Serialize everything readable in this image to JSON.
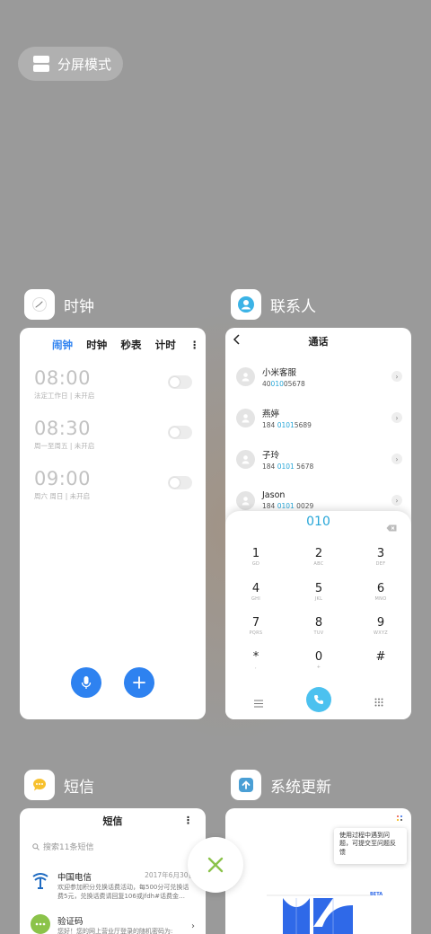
{
  "split_screen": {
    "label": "分屏模式"
  },
  "apps": {
    "clock": {
      "name": "时钟",
      "tabs": [
        "闹钟",
        "时钟",
        "秒表",
        "计时"
      ],
      "alarms": [
        {
          "time": "08:00",
          "sub": "法定工作日 | 未开启"
        },
        {
          "time": "08:30",
          "sub": "周一至周五 | 未开启"
        },
        {
          "time": "09:00",
          "sub": "周六 周日 | 未开启"
        }
      ]
    },
    "contacts": {
      "name": "联系人",
      "title": "通话",
      "items": [
        {
          "name": "小米客服",
          "num_pre": "40",
          "num_hl": "010",
          "num_post": "05678"
        },
        {
          "name": "燕婷",
          "num_pre": "184 ",
          "num_hl": "0101",
          "num_post": "5689"
        },
        {
          "name": "子玲",
          "num_pre": "184 ",
          "num_hl": "0101",
          "num_post": " 5678"
        },
        {
          "name": "Jason",
          "num_pre": "184 ",
          "num_hl": "0101",
          "num_post": " 0029"
        }
      ],
      "dialed": "010",
      "keys": [
        {
          "d": "1",
          "l": "GD"
        },
        {
          "d": "2",
          "l": "ABC"
        },
        {
          "d": "3",
          "l": "DEF"
        },
        {
          "d": "4",
          "l": "GHI"
        },
        {
          "d": "5",
          "l": "JKL"
        },
        {
          "d": "6",
          "l": "MNO"
        },
        {
          "d": "7",
          "l": "PQRS"
        },
        {
          "d": "8",
          "l": "TUV"
        },
        {
          "d": "9",
          "l": "WXYZ"
        },
        {
          "d": "*",
          "l": ","
        },
        {
          "d": "0",
          "l": "+"
        },
        {
          "d": "#",
          "l": ""
        }
      ]
    },
    "sms": {
      "name": "短信",
      "title": "短信",
      "search_placeholder": "搜索11条短信",
      "items": [
        {
          "sender": "中国电信",
          "date": "2017年6月30日",
          "preview": "欢迎参加积分兑换话费活动，每500分可兑换话费5元，兑换话费请回复106或jfdh#话费金…"
        },
        {
          "sender": "验证码",
          "date": "",
          "preview": "您好！您的网上营业厅登录的随机密码为:"
        }
      ]
    },
    "update": {
      "name": "系统更新",
      "tip": "使用过程中遇到问题，可提交至问题反馈",
      "beta": "BETA"
    }
  },
  "colors": {
    "accent_blue": "#2e82f0",
    "dial_blue": "#27a6d8",
    "close_green": "#8bc34a",
    "background": "#9a9a9a"
  }
}
